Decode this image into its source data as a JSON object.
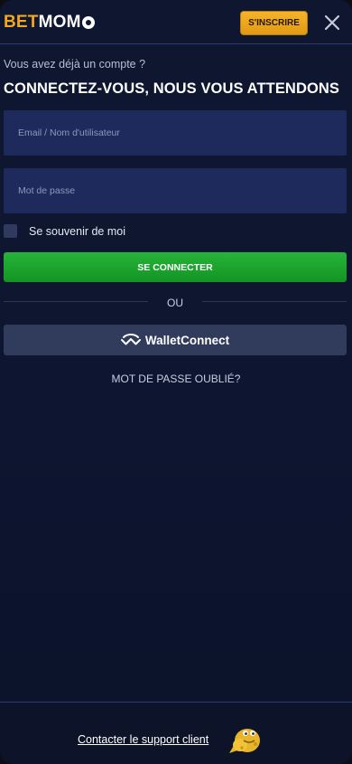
{
  "header": {
    "logo_bet": "BET",
    "logo_momo": "MOM",
    "signup_label": "S'INSCRIRE",
    "close_icon": "close-icon"
  },
  "login": {
    "subtitle": "Vous avez déjà un compte ?",
    "title": "CONNECTEZ-VOUS, NOUS VOUS ATTENDONS",
    "email_placeholder": "Email / Nom d'utilisateur",
    "password_placeholder": "Mot de passe",
    "remember_label": "Se souvenir de moi",
    "submit_label": "SE CONNECTER",
    "divider_label": "OU",
    "walletconnect_label": "WalletConnect",
    "forgot_label": "MOT DE PASSE OUBLIÉ?"
  },
  "footer": {
    "support_label": "Contacter le support client",
    "mascot_icon": "chat-mascot-icon"
  },
  "colors": {
    "accent_gold": "#f2a81d",
    "primary_green": "#1fa52e",
    "background": "#0f1730",
    "field": "#1d2a5b"
  }
}
